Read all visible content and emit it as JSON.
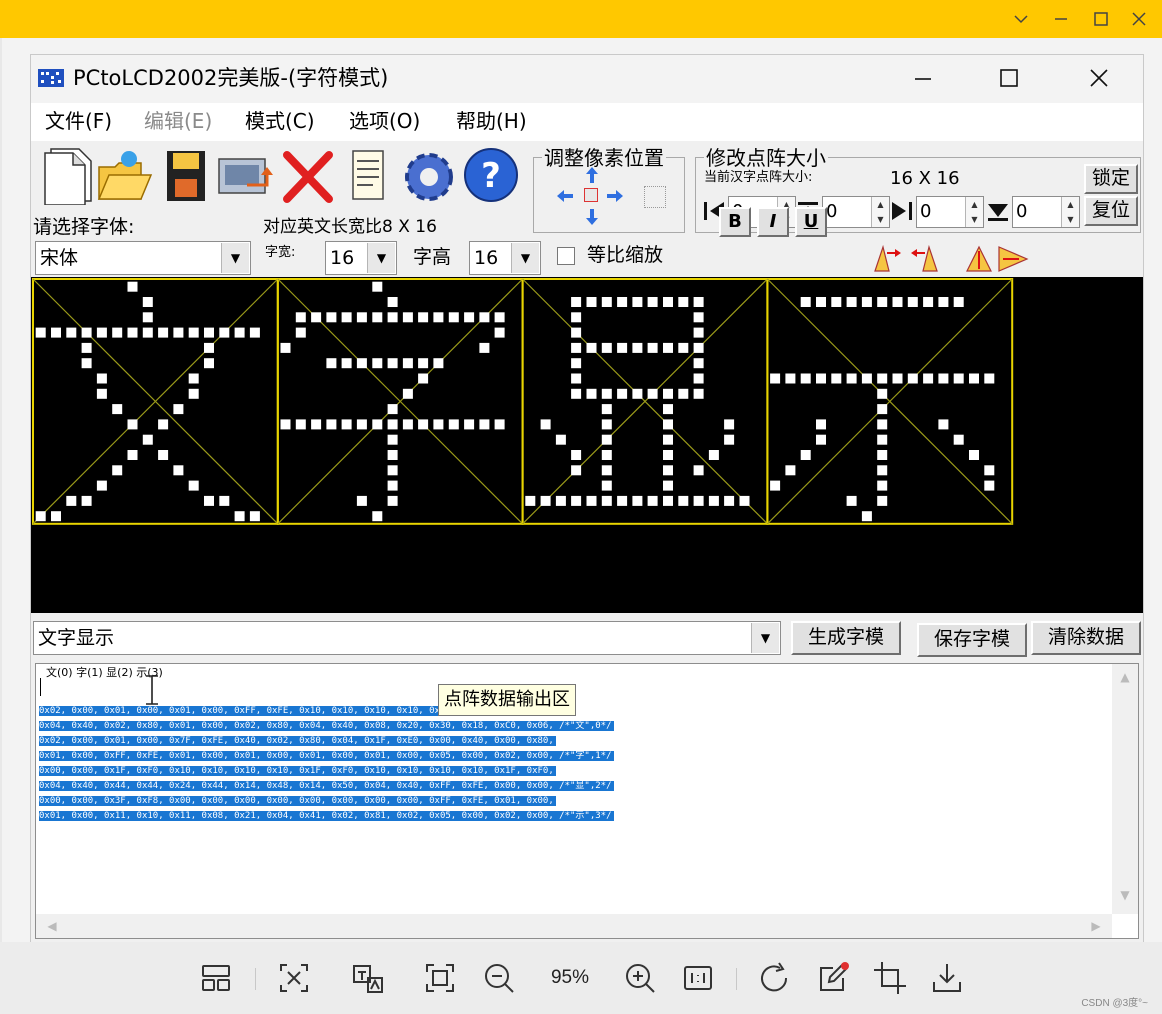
{
  "viewer": {
    "zoom": "95%",
    "watermark": "CSDN @3度°~",
    "toolbar_icons": [
      "gallery-view-icon",
      "ocr-translate-icon",
      "text-recognize-icon",
      "fit-window-icon",
      "zoom-out-icon",
      "zoom-in-icon",
      "actual-size-icon",
      "rotate-icon",
      "edit-icon",
      "crop-icon",
      "download-icon"
    ],
    "accent": "#ffc800"
  },
  "app": {
    "title": "PCtoLCD2002完美版-(字符模式)",
    "menu": [
      "文件(F)",
      "编辑(E)",
      "模式(C)",
      "选项(O)",
      "帮助(H)"
    ]
  },
  "pixel_group": {
    "title": "调整像素位置"
  },
  "size_group": {
    "title": "修改点阵大小",
    "current_label": "当前汉字点阵大小:",
    "current_value": "16 X 16",
    "spins": [
      "0",
      "0",
      "0",
      "0"
    ],
    "lock_button": "锁定",
    "reset_button": "复位"
  },
  "font": {
    "select_label": "请选择字体:",
    "font_name": "宋体",
    "ratio_label": "对应英文长宽比8 X 16",
    "width_label": "字宽:",
    "width_value": "16",
    "height_label": "字高",
    "height_value": "16",
    "proportional_label": "等比缩放"
  },
  "format_buttons": [
    "B",
    "I",
    "U"
  ],
  "glyph_text": "文字显示",
  "output": {
    "input_value": "文字显示",
    "generate_button": "生成字模",
    "save_button": "保存字模",
    "clear_button": "清除数据",
    "char_list": "文(0)  字(1)  显(2)  示(3)",
    "tooltip": "点阵数据输出区",
    "code_lines": [
      "0x02, 0x00, 0x01, 0x00, 0x01, 0x00, 0xFF, 0xFE, 0x10, 0x10, 0x10, 0x10, 0x08, 0x20, 0x08, 0x20,",
      "0x04, 0x40, 0x02, 0x80, 0x01, 0x00, 0x02, 0x80, 0x04, 0x40, 0x08, 0x20, 0x30, 0x18, 0xC0, 0x06, /*\"文\",0*/",
      "0x02, 0x00, 0x01, 0x00, 0x7F, 0xFE, 0x40, 0x02, 0x80, 0x04, 0x1F, 0xE0, 0x00, 0x40, 0x00, 0x80,",
      "0x01, 0x00, 0xFF, 0xFE, 0x01, 0x00, 0x01, 0x00, 0x01, 0x00, 0x01, 0x00, 0x05, 0x00, 0x02, 0x00, /*\"字\",1*/",
      "0x00, 0x00, 0x1F, 0xF0, 0x10, 0x10, 0x10, 0x10, 0x1F, 0xF0, 0x10, 0x10, 0x10, 0x10, 0x1F, 0xF0,",
      "0x04, 0x40, 0x44, 0x44, 0x24, 0x44, 0x14, 0x48, 0x14, 0x50, 0x04, 0x40, 0xFF, 0xFE, 0x00, 0x00, /*\"显\",2*/",
      "0x00, 0x00, 0x3F, 0xF8, 0x00, 0x00, 0x00, 0x00, 0x00, 0x00, 0x00, 0x00, 0xFF, 0xFE, 0x01, 0x00,",
      "0x01, 0x00, 0x11, 0x10, 0x11, 0x08, 0x21, 0x04, 0x41, 0x02, 0x81, 0x02, 0x05, 0x00, 0x02, 0x00, /*\"示\",3*/"
    ]
  }
}
